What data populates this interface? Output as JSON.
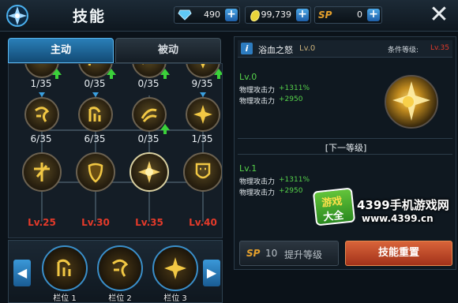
{
  "header": {
    "title": "技能",
    "diamonds": "490",
    "coins": "99,739",
    "sp_label": "SP",
    "sp_value": "0",
    "close_icon": "close-icon"
  },
  "tabs": [
    {
      "label": "主动",
      "active": true
    },
    {
      "label": "被动",
      "active": false
    }
  ],
  "tree": {
    "row0": [
      "1/35",
      "0/35",
      "0/35",
      "9/35"
    ],
    "row1": [
      "6/35",
      "6/35",
      "0/35",
      "1/35"
    ],
    "row2": [
      "Lv.25",
      "Lv.30",
      "Lv.35",
      "Lv.40"
    ]
  },
  "slots": [
    "栏位 1",
    "栏位 2",
    "栏位 3"
  ],
  "skill": {
    "name": "浴血之怒",
    "level": "Lv.0",
    "req_label": "条件等级:",
    "req_value": "Lv.35",
    "current": {
      "lv": "Lv.0",
      "stats": [
        {
          "name": "物理攻击力",
          "value": "+1311%"
        },
        {
          "name": "物理攻击力",
          "value": "+2950"
        }
      ]
    },
    "next_level_label": "[下一等级]",
    "next": {
      "lv": "Lv.1",
      "stats": [
        {
          "name": "物理攻击力",
          "value": "+1311%"
        },
        {
          "name": "物理攻击力",
          "value": "+2950"
        }
      ]
    }
  },
  "buttons": {
    "upgrade_sp": "SP",
    "upgrade_cost": "10",
    "upgrade_label": "提升等级",
    "reset_label": "技能重置"
  },
  "watermark": {
    "badge_top": "游戏",
    "badge_bottom": "大全",
    "site_name": "4399手机游戏网",
    "site_url": "www.4399.cn"
  },
  "colors": {
    "accent_blue": "#2a7fb8",
    "level_red": "#e43a2a",
    "stat_green": "#56d24a",
    "reset_orange": "#d9643a"
  }
}
